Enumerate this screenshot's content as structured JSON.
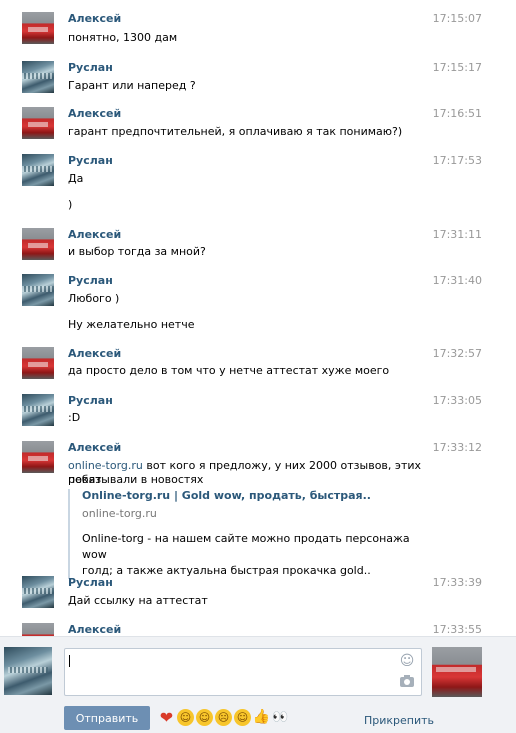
{
  "messages": [
    {
      "author": "Алексей",
      "time": "17:15:07",
      "lines": [
        "понятно, 1300 дам"
      ],
      "avatar": "car"
    },
    {
      "author": "Руслан",
      "time": "17:15:17",
      "lines": [
        "Гарант или наперед ?"
      ],
      "avatar": "city"
    },
    {
      "author": "Алексей",
      "time": "17:16:51",
      "lines": [
        "гарант предпочтительней, я оплачиваю я так понимаю?)"
      ],
      "avatar": "car"
    },
    {
      "author": "Руслан",
      "time": "17:17:53",
      "lines": [
        "Да",
        ")"
      ],
      "avatar": "city"
    },
    {
      "author": "Алексей",
      "time": "17:31:11",
      "lines": [
        "и выбор тогда за мной?"
      ],
      "avatar": "car"
    },
    {
      "author": "Руслан",
      "time": "17:31:40",
      "lines": [
        "Любого )",
        "Ну желательно нетче"
      ],
      "avatar": "city"
    },
    {
      "author": "Алексей",
      "time": "17:32:57",
      "lines": [
        "да просто дело в том что у нетче аттестат хуже моего"
      ],
      "avatar": "car"
    },
    {
      "author": "Руслан",
      "time": "17:33:05",
      "lines": [
        ":D"
      ],
      "avatar": "city"
    },
    {
      "author": "Алексей",
      "time": "17:33:12",
      "avatar": "car",
      "link_text": "online-torg.ru",
      "text_after_link": " вот кого я предложу, у них 2000 отзывов, этих ребят",
      "line2": "показывали в новостях",
      "snippet": {
        "title": "Online-torg.ru  |  Gold wow, продать, быстрая..",
        "domain": "online-torg.ru",
        "text_line1": "Online-torg - на нашем сайте можно продать персонажа wow",
        "text_line2": "голд; а также актуальна быстрая прокачка gold.."
      }
    },
    {
      "author": "Руслан",
      "time": "17:33:39",
      "lines": [
        "Дай ссылку на аттестат"
      ],
      "avatar": "city"
    },
    {
      "author": "Алексей",
      "time": "17:33:55",
      "lines": [],
      "avatar": "car"
    }
  ],
  "composer": {
    "input_value": "",
    "send_label": "Отправить",
    "attach_label": "Прикрепить",
    "emojis": [
      "heart-icon",
      "grin-emoji-icon",
      "relieved-emoji-icon",
      "scared-emoji-icon",
      "smile-emoji-icon",
      "thumbs-up-icon",
      "eyes-icon"
    ]
  },
  "colors": {
    "accent": "#2b587a",
    "button": "#6d8fb3",
    "timestamp": "#999999"
  }
}
